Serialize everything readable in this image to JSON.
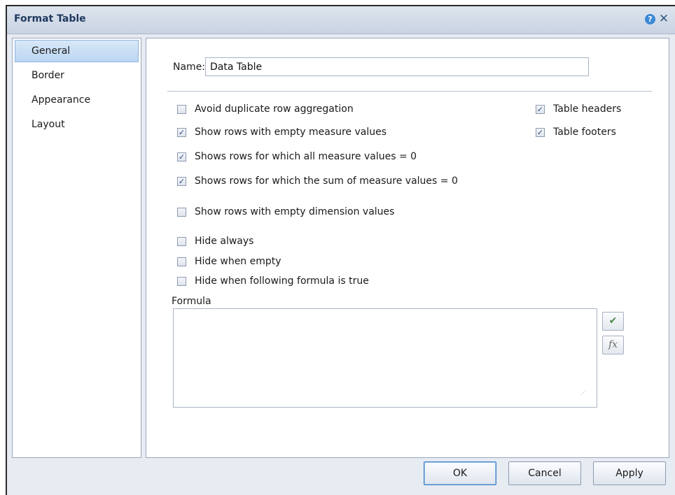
{
  "dialog": {
    "title": "Format Table",
    "help_symbol": "?",
    "close_symbol": "✕"
  },
  "sidebar": {
    "items": [
      {
        "label": "General",
        "selected": true
      },
      {
        "label": "Border",
        "selected": false
      },
      {
        "label": "Appearance",
        "selected": false
      },
      {
        "label": "Layout",
        "selected": false
      }
    ]
  },
  "general": {
    "name_label": "Name:",
    "name_value": "Data Table",
    "options": [
      {
        "label": "Avoid duplicate row aggregation",
        "checked": false
      },
      {
        "label": "Show rows with empty measure values",
        "checked": true
      },
      {
        "label": "Shows rows for which all measure values = 0",
        "checked": true
      },
      {
        "label": "Shows rows for which the sum of measure values = 0",
        "checked": true
      },
      {
        "label": "Show rows with empty dimension values",
        "checked": false
      },
      {
        "label": "Hide always",
        "checked": false
      },
      {
        "label": "Hide when empty",
        "checked": false
      },
      {
        "label": "Hide when following formula is true",
        "checked": false
      }
    ],
    "table_options": [
      {
        "label": "Table headers",
        "checked": true
      },
      {
        "label": "Table footers",
        "checked": true
      }
    ],
    "formula_label": "Formula",
    "formula_value": "",
    "validate_symbol": "✔",
    "function_symbol": "fx"
  },
  "footer": {
    "ok_label": "OK",
    "cancel_label": "Cancel",
    "apply_label": "Apply"
  },
  "colors": {
    "title": "#1f3a5f",
    "check": "#2b4f86",
    "selected_nav": "#bcd6f2"
  }
}
